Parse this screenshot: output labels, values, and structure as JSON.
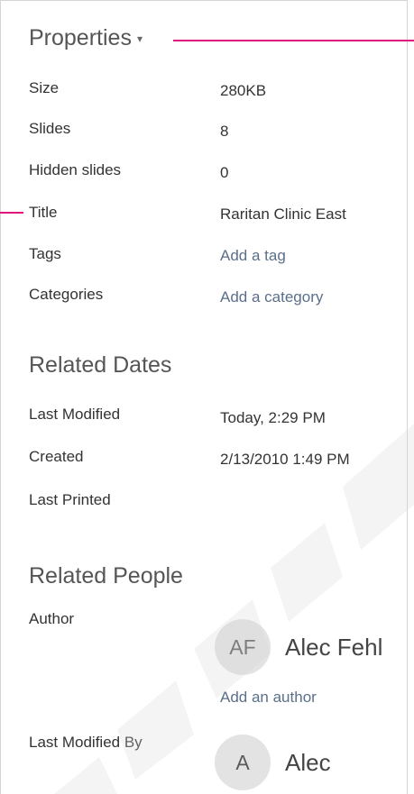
{
  "properties": {
    "heading": "Properties",
    "caret_icon": "▾",
    "rows": [
      {
        "label": "Size",
        "value": "280KB",
        "is_link": false
      },
      {
        "label": "Slides",
        "value": "8",
        "is_link": false
      },
      {
        "label": "Hidden slides",
        "value": "0",
        "is_link": false
      },
      {
        "label": "Title",
        "value": "Raritan Clinic East",
        "is_link": false
      },
      {
        "label": "Tags",
        "value": "Add a tag",
        "is_link": true
      },
      {
        "label": "Categories",
        "value": "Add a category",
        "is_link": true
      }
    ]
  },
  "related_dates": {
    "heading": "Related Dates",
    "rows": [
      {
        "label": "Last Modified",
        "value": "Today, 2:29 PM"
      },
      {
        "label": "Created",
        "value": "2/13/2010 1:49 PM"
      },
      {
        "label": "Last Printed",
        "value": ""
      }
    ]
  },
  "related_people": {
    "heading": "Related People",
    "author_label": "Author",
    "author": {
      "initials": "AF",
      "name": "Alec Fehl"
    },
    "add_author": "Add an author",
    "last_modified_by_label": "Last Modified By",
    "last_modified_by": {
      "initials": "A",
      "name": "Alec"
    }
  },
  "colors": {
    "callout": "#e0157c",
    "link": "#5a6f8a",
    "avatar_bg": "#e3e3e3"
  }
}
